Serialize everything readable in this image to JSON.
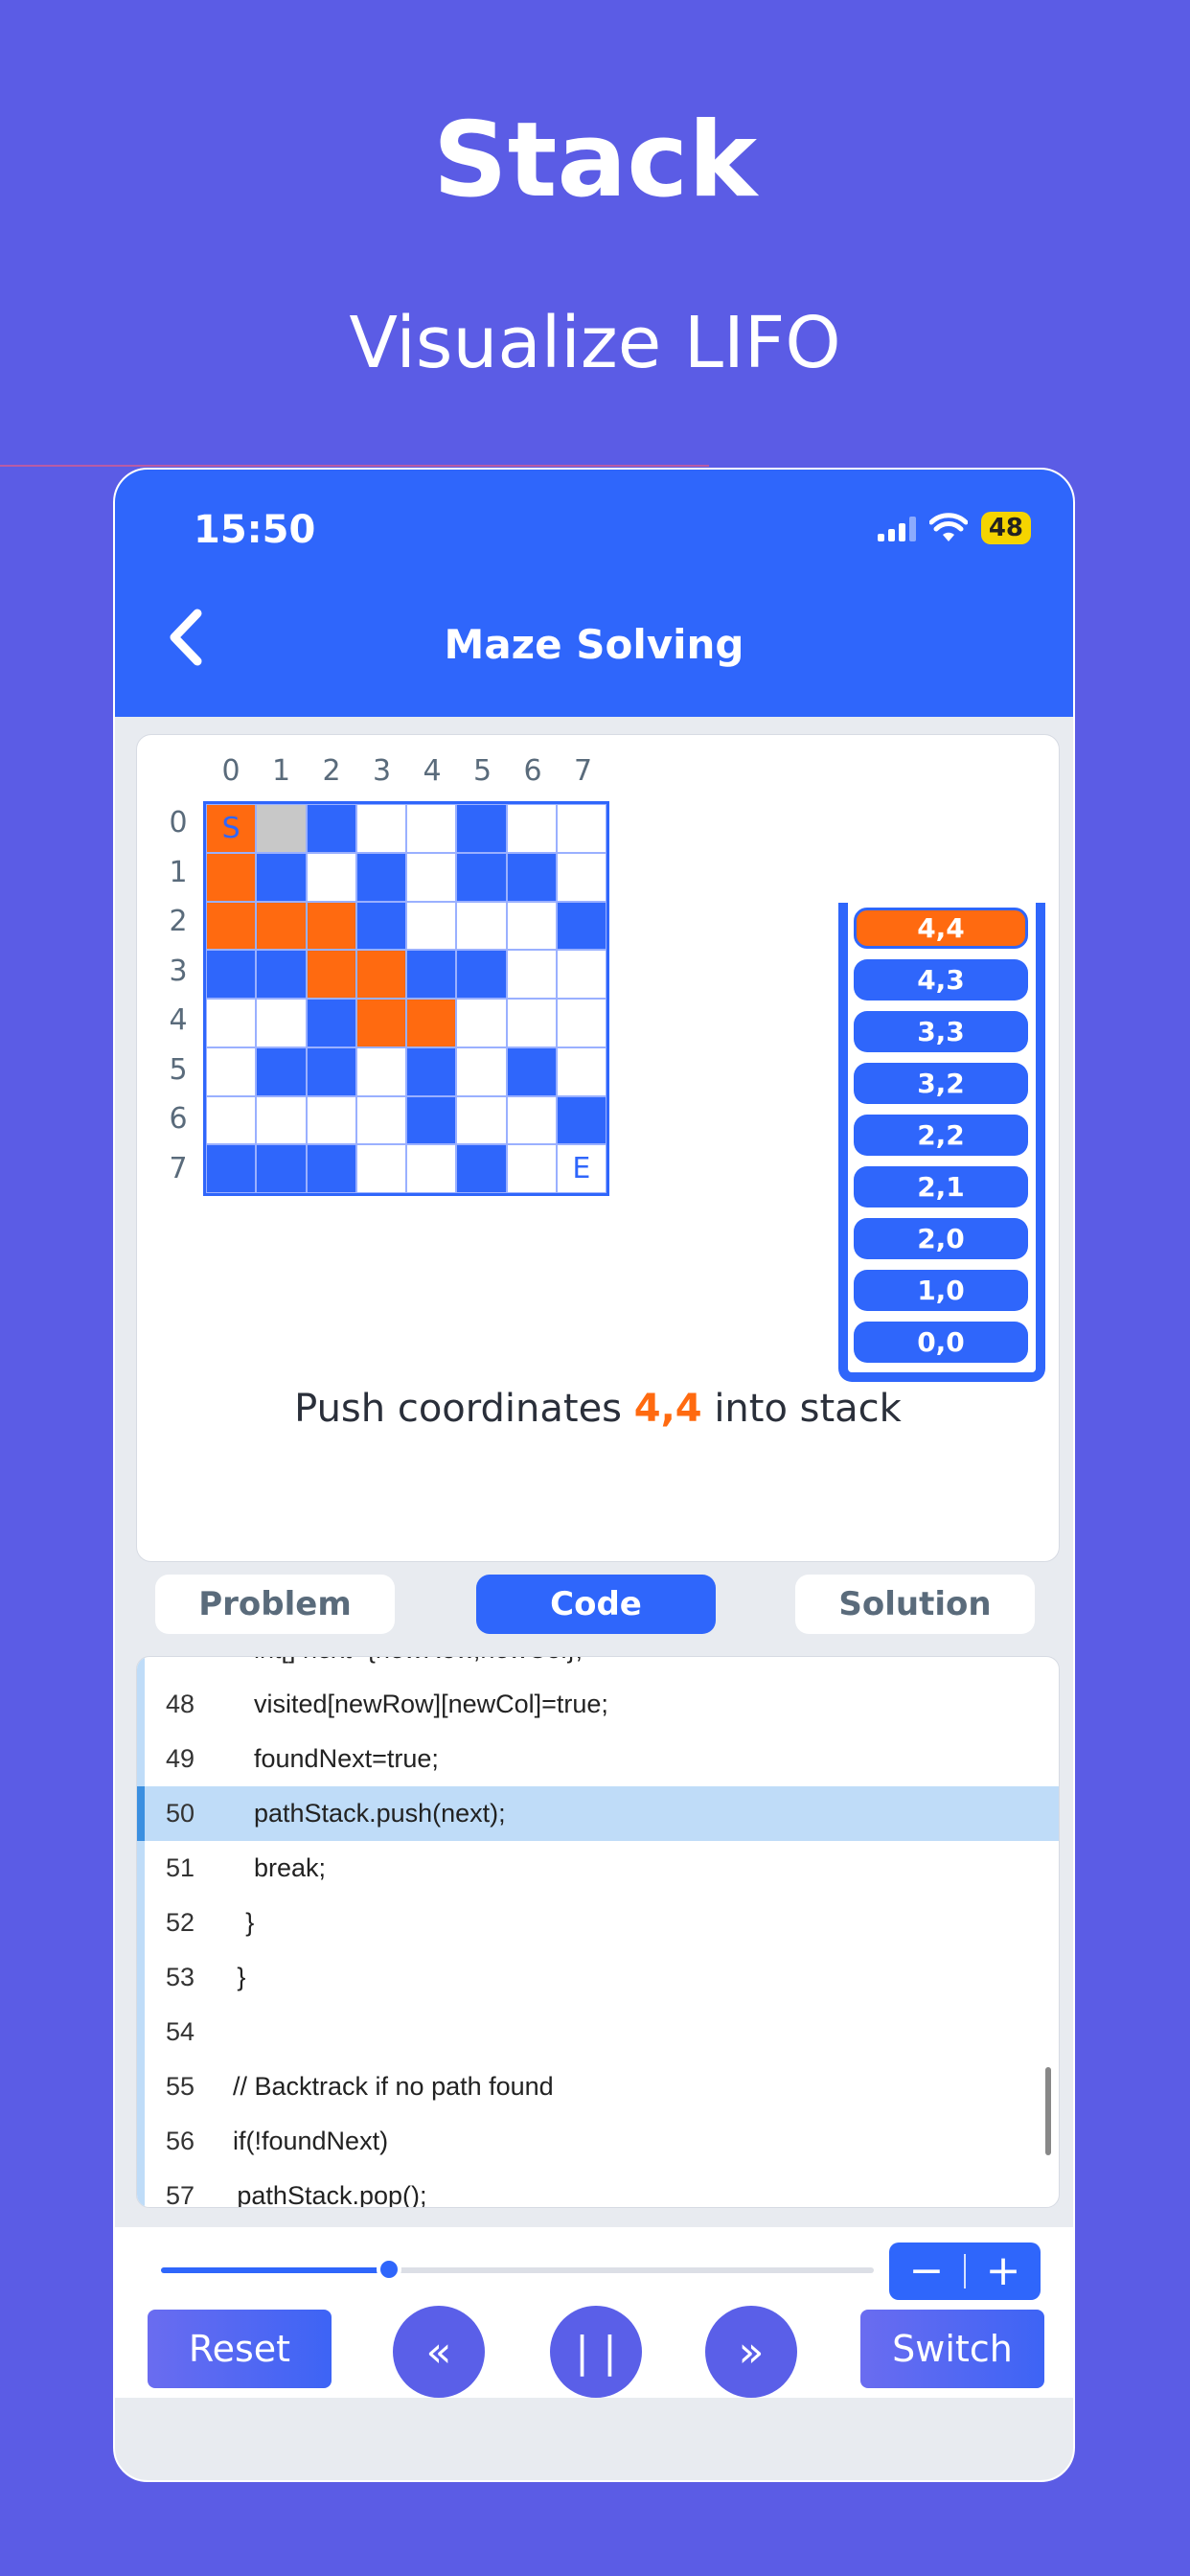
{
  "hero": {
    "title": "Stack",
    "subtitle": "Visualize LIFO"
  },
  "status_bar": {
    "time": "15:50",
    "battery": "48"
  },
  "nav": {
    "title": "Maze Solving",
    "back_icon": "chevron-left-icon"
  },
  "maze": {
    "col_labels": [
      "0",
      "1",
      "2",
      "3",
      "4",
      "5",
      "6",
      "7"
    ],
    "row_labels": [
      "0",
      "1",
      "2",
      "3",
      "4",
      "5",
      "6",
      "7"
    ],
    "cells": [
      [
        "S",
        "G",
        "B",
        "W",
        "W",
        "B",
        "W",
        "W"
      ],
      [
        "O",
        "B",
        "W",
        "B",
        "W",
        "B",
        "B",
        "W"
      ],
      [
        "O",
        "O",
        "O",
        "B",
        "W",
        "W",
        "W",
        "B"
      ],
      [
        "B",
        "B",
        "O",
        "O",
        "B",
        "B",
        "W",
        "W"
      ],
      [
        "W",
        "W",
        "B",
        "O",
        "O",
        "W",
        "W",
        "W"
      ],
      [
        "W",
        "B",
        "B",
        "W",
        "B",
        "W",
        "B",
        "W"
      ],
      [
        "W",
        "W",
        "W",
        "W",
        "B",
        "W",
        "W",
        "B"
      ],
      [
        "B",
        "B",
        "B",
        "W",
        "W",
        "B",
        "W",
        "E"
      ]
    ],
    "start_label": "S",
    "end_label": "E",
    "colors": {
      "wall": "#2f66fb",
      "open": "#ffffff",
      "path": "#ff6a10",
      "visited": "#c8c8c8"
    }
  },
  "stack": {
    "items": [
      "4,4",
      "4,3",
      "3,3",
      "3,2",
      "2,2",
      "2,1",
      "2,0",
      "1,0",
      "0,0"
    ]
  },
  "caption": {
    "prefix": "Push coordinates",
    "highlight": "4,4",
    "suffix": "into stack"
  },
  "tabs": [
    {
      "label": "Problem",
      "active": false
    },
    {
      "label": "Code",
      "active": true
    },
    {
      "label": "Solution",
      "active": false
    }
  ],
  "code": {
    "lines": [
      {
        "n": "48",
        "text": "visited[newRow][newCol]=true;",
        "indent": 1
      },
      {
        "n": "49",
        "text": "foundNext=true;",
        "indent": 1
      },
      {
        "n": "50",
        "text": "pathStack.push(next);",
        "indent": 1,
        "highlight": true
      },
      {
        "n": "51",
        "text": "break;",
        "indent": 1
      },
      {
        "n": "52",
        "text": "}",
        "indent": 0.6
      },
      {
        "n": "53",
        "text": "}",
        "indent": 0.2
      },
      {
        "n": "54",
        "text": "",
        "indent": 0
      },
      {
        "n": "55",
        "text": "// Backtrack if no path found",
        "indent": 0
      },
      {
        "n": "56",
        "text": "if(!foundNext)",
        "indent": 0
      },
      {
        "n": "57",
        "text": "pathStack.pop();",
        "indent": 0.2
      }
    ],
    "partial_top": "int[] next={newRow,newCol};"
  },
  "controls": {
    "progress": 0.32,
    "reset_label": "Reset",
    "switch_label": "Switch",
    "zoom_out": "−",
    "zoom_in": "+",
    "rewind": "«",
    "pause": "| |",
    "forward": "»"
  }
}
